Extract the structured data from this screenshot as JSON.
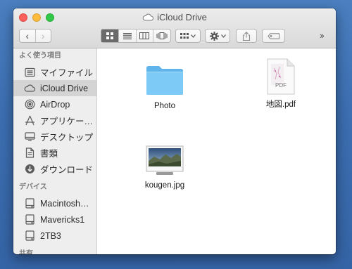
{
  "window": {
    "title": "iCloud Drive"
  },
  "toolbar": {
    "back": "‹",
    "forward": "›",
    "more": "››"
  },
  "sidebar": {
    "sections": [
      {
        "header": "よく使う項目",
        "items": [
          {
            "label": "マイファイル",
            "icon": "all-files-icon",
            "selected": false
          },
          {
            "label": "iCloud Drive",
            "icon": "cloud-icon",
            "selected": true
          },
          {
            "label": "AirDrop",
            "icon": "airdrop-icon",
            "selected": false
          },
          {
            "label": "アプリケー…",
            "icon": "applications-icon",
            "selected": false
          },
          {
            "label": "デスクトップ",
            "icon": "desktop-icon",
            "selected": false
          },
          {
            "label": "書類",
            "icon": "documents-icon",
            "selected": false
          },
          {
            "label": "ダウンロード",
            "icon": "downloads-icon",
            "selected": false
          }
        ]
      },
      {
        "header": "デバイス",
        "items": [
          {
            "label": "Macintosh…",
            "icon": "disk-icon"
          },
          {
            "label": "Mavericks1",
            "icon": "disk-icon"
          },
          {
            "label": "2TB3",
            "icon": "disk-icon"
          }
        ]
      },
      {
        "header": "共有",
        "items": []
      }
    ]
  },
  "files": [
    {
      "name": "Photo",
      "kind": "folder"
    },
    {
      "name": "地図.pdf",
      "kind": "pdf",
      "badge": "PDF"
    },
    {
      "name": "kougen.jpg",
      "kind": "image"
    }
  ],
  "colors": {
    "folder": "#6cc1f4",
    "selection": "#d4d4d4"
  }
}
